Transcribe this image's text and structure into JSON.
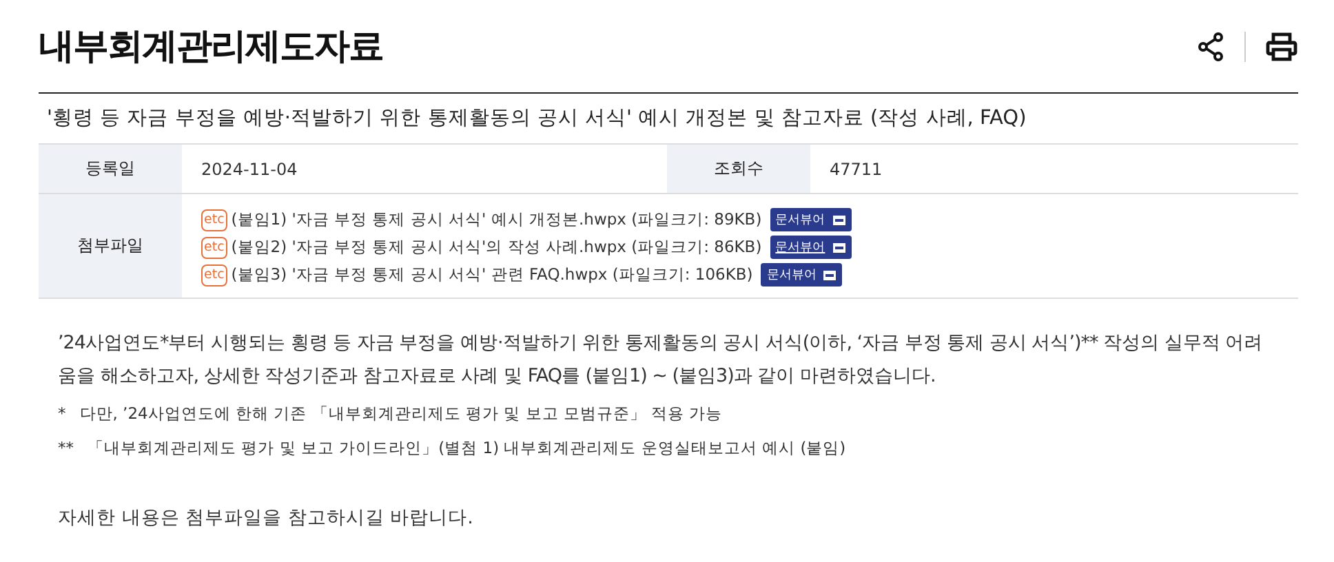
{
  "page": {
    "title": "내부회계관리제도자료"
  },
  "post": {
    "subject": "'횡령 등 자금 부정을 예방·적발하기 위한 통제활동의 공시 서식' 예시 개정본 및 참고자료 (작성 사례, FAQ)",
    "meta": [
      {
        "label": "등록일",
        "value": "2024-11-04"
      },
      {
        "label": "조회수",
        "value": "47711"
      }
    ],
    "attachments_label": "첨부파일",
    "attachments": [
      {
        "badge": "etc",
        "name": "(붙임1) '자금 부정 통제 공시 서식' 예시 개정본.hwpx (파일크기: 89KB)",
        "viewer": "문서뷰어",
        "hovered": false
      },
      {
        "badge": "etc",
        "name": "(붙임2) '자금 부정 통제 공시 서식'의 작성 사례.hwpx (파일크기: 86KB)",
        "viewer": "문서뷰어",
        "hovered": true
      },
      {
        "badge": "etc",
        "name": "(붙임3) '자금 부정 통제 공시 서식' 관련 FAQ.hwpx (파일크기: 106KB)",
        "viewer": "문서뷰어",
        "hovered": false
      }
    ],
    "body": "’24사업연도*부터 시행되는 횡령 등 자금 부정을 예방·적발하기 위한 통제활동의 공시 서식(이하, ‘자금 부정 통제 공시 서식’)** 작성의 실무적 어려움을 해소하고자, 상세한 작성기준과 참고자료로 사례 및 FAQ를 (붙임1) ~ (붙임3)과 같이 마련하였습니다.",
    "notes": [
      {
        "mark": "*",
        "text": "다만, ’24사업연도에 한해 기존 「내부회계관리제도 평가 및 보고 모범규준」 적용 가능"
      },
      {
        "mark": "**",
        "text": "「내부회계관리제도 평가 및 보고 가이드라인」(별첨 1) 내부회계관리제도 운영실태보고서 예시 (붙임)"
      }
    ],
    "closing": "자세한 내용은 첨부파일을 참고하시길 바랍니다."
  }
}
